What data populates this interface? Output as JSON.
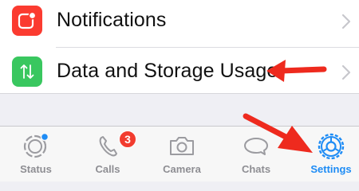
{
  "settings_list": {
    "items": [
      {
        "label": "Notifications",
        "icon": "notification-app-icon",
        "icon_color": "#fb3b30"
      },
      {
        "label": "Data and Storage Usage",
        "icon": "up-down-arrows-icon",
        "icon_color": "#39c75f"
      }
    ]
  },
  "tabbar": {
    "tabs": [
      {
        "label": "Status",
        "icon": "status-ring-icon",
        "active": false
      },
      {
        "label": "Calls",
        "icon": "phone-icon",
        "active": false,
        "badge": "3"
      },
      {
        "label": "Camera",
        "icon": "camera-icon",
        "active": false
      },
      {
        "label": "Chats",
        "icon": "chat-bubbles-icon",
        "active": false
      },
      {
        "label": "Settings",
        "icon": "gear-icon",
        "active": true
      }
    ],
    "active_color": "#1e8cf5",
    "inactive_color": "#8e8e93"
  },
  "annotations": {
    "arrow_color": "#ee2a1e"
  }
}
